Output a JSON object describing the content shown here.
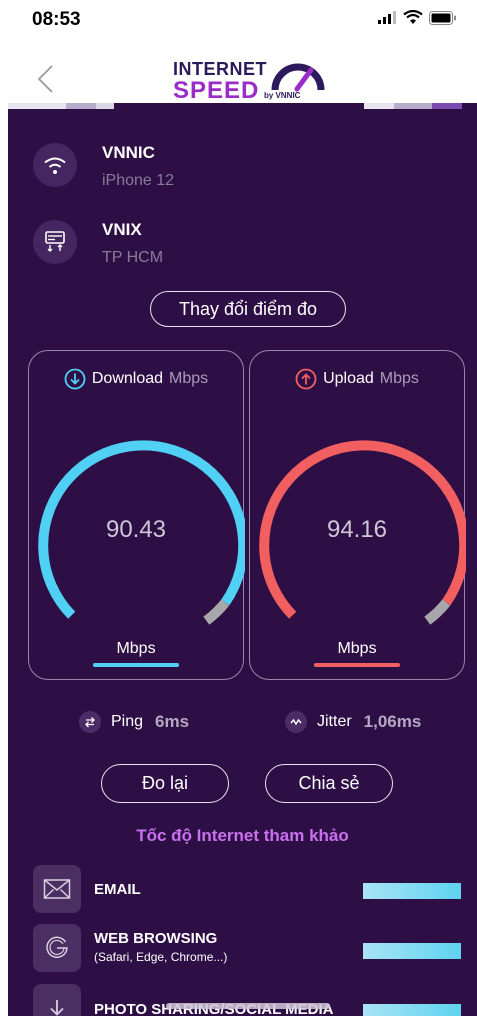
{
  "status_bar": {
    "time": "08:53"
  },
  "header": {
    "logo_line1": "INTERNET",
    "logo_line2": "SPEED",
    "logo_by": "by VNNIC"
  },
  "provider": {
    "name": "VNNIC",
    "device": "iPhone 12"
  },
  "server": {
    "name": "VNIX",
    "location": "TP HCM"
  },
  "change_server_label": "Thay đổi điểm đo",
  "download": {
    "label": "Download",
    "unit_label": "Mbps",
    "value": "90.43",
    "unit": "Mbps",
    "color": "#4fd0f4"
  },
  "upload": {
    "label": "Upload",
    "unit_label": "Mbps",
    "value": "94.16",
    "unit": "Mbps",
    "color": "#f25f60"
  },
  "ping": {
    "label": "Ping",
    "value": "6ms"
  },
  "jitter": {
    "label": "Jitter",
    "value": "1,06ms"
  },
  "actions": {
    "retest_label": "Đo lại",
    "share_label": "Chia sẻ"
  },
  "reference": {
    "title": "Tốc độ Internet tham khảo",
    "items": [
      {
        "label": "EMAIL",
        "sub": "",
        "icon": "mail-icon"
      },
      {
        "label": "WEB BROWSING",
        "sub": "(Safari, Edge, Chrome...)",
        "icon": "google-icon"
      },
      {
        "label": "PHOTO SHARING/SOCIAL MEDIA",
        "sub": "",
        "icon": "download-icon"
      }
    ]
  },
  "colors": {
    "background": "#2e0f45",
    "accent": "#c870ee"
  }
}
